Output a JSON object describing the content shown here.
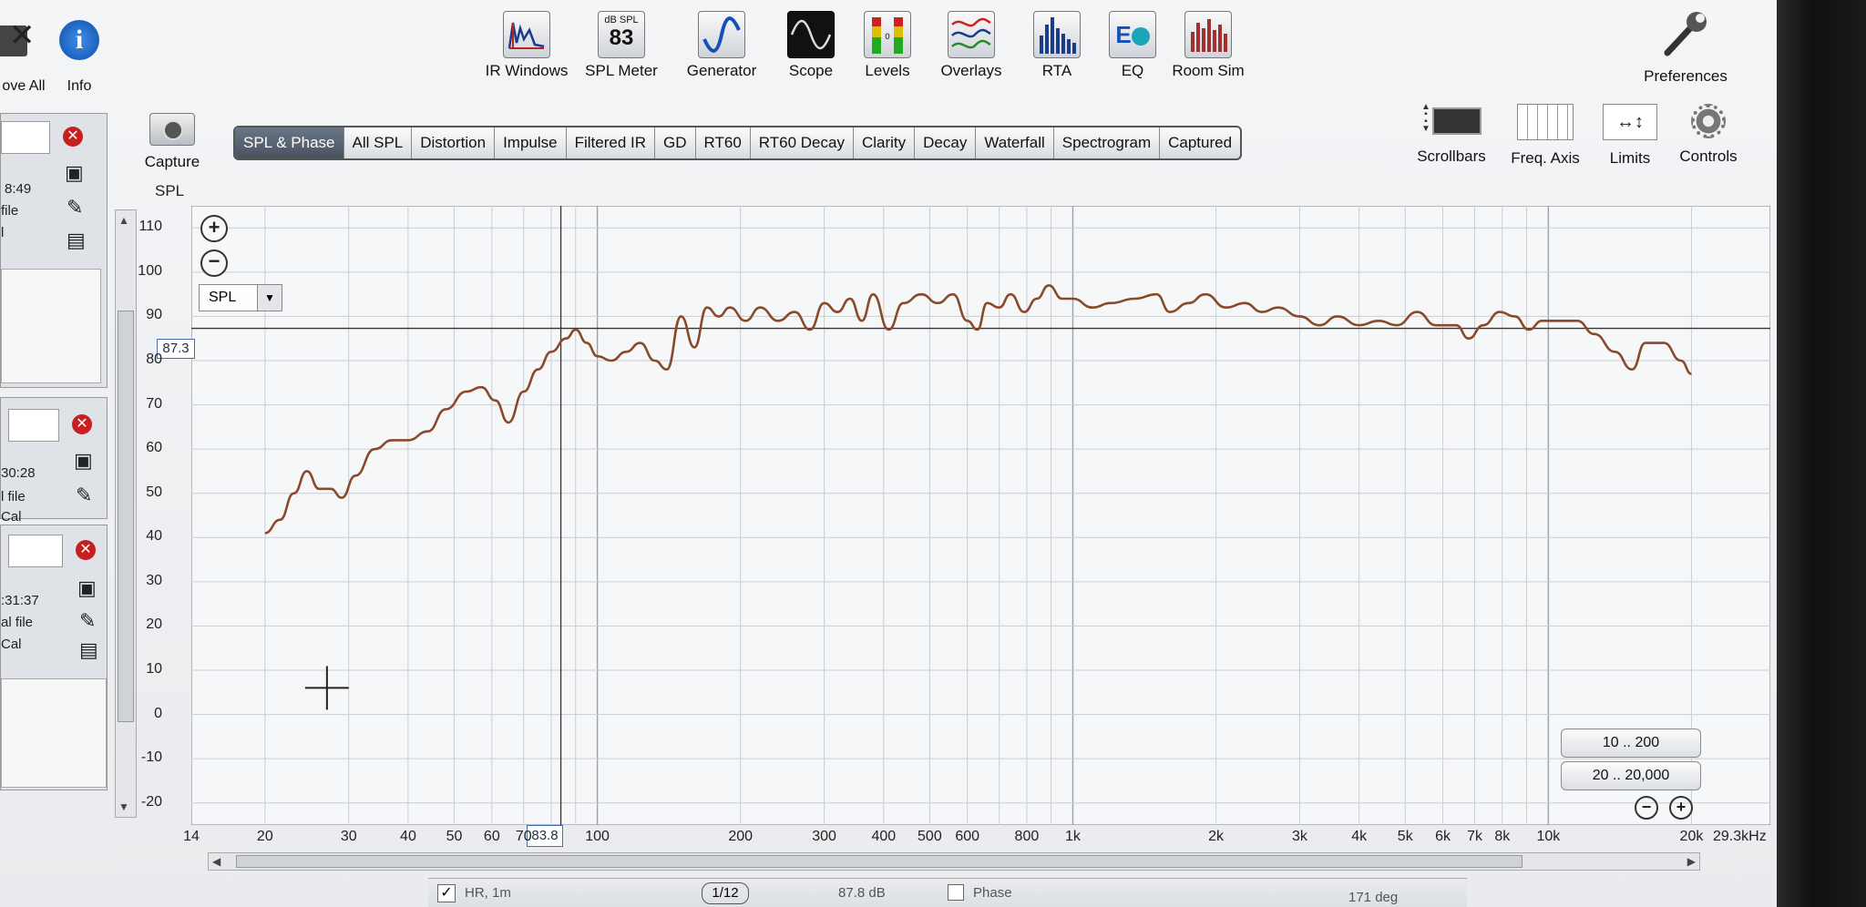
{
  "toolbar": {
    "left_items": [
      {
        "label": "ove All",
        "icon": "remove-all-icon"
      },
      {
        "label": "Info",
        "icon": "info-icon"
      }
    ],
    "items": [
      {
        "label": "IR Windows",
        "icon": "ir-windows-icon"
      },
      {
        "label": "SPL Meter",
        "icon": "spl-meter-icon",
        "icon_top": "dB SPL",
        "icon_value": "83"
      },
      {
        "label": "Generator",
        "icon": "generator-icon"
      },
      {
        "label": "Scope",
        "icon": "scope-icon"
      },
      {
        "label": "Levels",
        "icon": "levels-icon"
      },
      {
        "label": "Overlays",
        "icon": "overlays-icon"
      },
      {
        "label": "RTA",
        "icon": "rta-icon"
      },
      {
        "label": "EQ",
        "icon": "eq-icon"
      },
      {
        "label": "Room Sim",
        "icon": "room-sim-icon"
      }
    ],
    "preferences": "Preferences"
  },
  "capture": {
    "label": "Capture"
  },
  "graph_tabs": [
    "SPL & Phase",
    "All SPL",
    "Distortion",
    "Impulse",
    "Filtered IR",
    "GD",
    "RT60",
    "RT60 Decay",
    "Clarity",
    "Decay",
    "Waterfall",
    "Spectrogram",
    "Captured"
  ],
  "active_tab": "SPL & Phase",
  "right_tools": [
    {
      "label": "Scrollbars",
      "icon": "scrollbars-icon"
    },
    {
      "label": "Freq. Axis",
      "icon": "freq-axis-icon"
    },
    {
      "label": "Limits",
      "icon": "limits-icon"
    },
    {
      "label": "Controls",
      "icon": "gear-icon"
    }
  ],
  "side_measurements": [
    {
      "time": "8:49",
      "line2": "file",
      "line3": "l"
    },
    {
      "time": "30:28",
      "line2": "l file",
      "line3": "Cal"
    },
    {
      "time": ":31:37",
      "line2": "al file",
      "line3": "Cal"
    }
  ],
  "graph": {
    "y_axis_label": "SPL",
    "selector_value": "SPL",
    "cursor_y_value": "87.3",
    "cursor_x_value": "83.8",
    "x_end_label": "29.3kHz",
    "range_buttons": [
      "10 .. 200",
      "20 .. 20,000"
    ]
  },
  "status_bar": {
    "checkbox_label": "HR, 1m",
    "smoothing": "1/12",
    "level": "87.8 dB",
    "phase_label": "Phase",
    "phase_value": "171 deg"
  },
  "chart_data": {
    "type": "line",
    "ylabel": "SPL",
    "x_scale": "log",
    "xlim": [
      14,
      29300
    ],
    "ylim": [
      -25,
      115
    ],
    "y_ticks": [
      110,
      100,
      90,
      80,
      70,
      60,
      50,
      40,
      30,
      20,
      10,
      0,
      -10,
      -20
    ],
    "x_ticks": [
      {
        "v": 14,
        "label": "14"
      },
      {
        "v": 20,
        "label": "20"
      },
      {
        "v": 30,
        "label": "30"
      },
      {
        "v": 40,
        "label": "40"
      },
      {
        "v": 50,
        "label": "50"
      },
      {
        "v": 60,
        "label": "60"
      },
      {
        "v": 70,
        "label": "70"
      },
      {
        "v": 100,
        "label": "100"
      },
      {
        "v": 200,
        "label": "200"
      },
      {
        "v": 300,
        "label": "300"
      },
      {
        "v": 400,
        "label": "400"
      },
      {
        "v": 500,
        "label": "500"
      },
      {
        "v": 600,
        "label": "600"
      },
      {
        "v": 800,
        "label": "800"
      },
      {
        "v": 1000,
        "label": "1k"
      },
      {
        "v": 2000,
        "label": "2k"
      },
      {
        "v": 3000,
        "label": "3k"
      },
      {
        "v": 4000,
        "label": "4k"
      },
      {
        "v": 5000,
        "label": "5k"
      },
      {
        "v": 6000,
        "label": "6k"
      },
      {
        "v": 7000,
        "label": "7k"
      },
      {
        "v": 8000,
        "label": "8k"
      },
      {
        "v": 10000,
        "label": "10k"
      },
      {
        "v": 20000,
        "label": "20k"
      }
    ],
    "cursor": {
      "x": 83.8,
      "y": 87.3
    },
    "series": [
      {
        "color": "#8a4a2a",
        "points": [
          [
            20,
            41
          ],
          [
            21.5,
            44
          ],
          [
            23,
            50
          ],
          [
            24.5,
            55
          ],
          [
            26,
            51
          ],
          [
            27.5,
            51
          ],
          [
            29,
            49
          ],
          [
            31,
            54
          ],
          [
            34,
            60
          ],
          [
            37,
            62
          ],
          [
            40,
            62
          ],
          [
            44,
            64
          ],
          [
            48,
            69
          ],
          [
            53,
            73
          ],
          [
            57,
            74
          ],
          [
            61,
            71
          ],
          [
            65,
            66
          ],
          [
            70,
            73
          ],
          [
            75,
            78
          ],
          [
            80,
            82
          ],
          [
            86,
            85
          ],
          [
            90,
            87
          ],
          [
            95,
            84
          ],
          [
            100,
            81
          ],
          [
            107,
            80
          ],
          [
            115,
            82
          ],
          [
            123,
            84
          ],
          [
            132,
            80
          ],
          [
            140,
            78
          ],
          [
            150,
            90
          ],
          [
            160,
            83
          ],
          [
            170,
            92
          ],
          [
            180,
            90
          ],
          [
            190,
            92
          ],
          [
            205,
            89
          ],
          [
            220,
            92
          ],
          [
            240,
            89
          ],
          [
            260,
            91
          ],
          [
            280,
            87
          ],
          [
            300,
            93
          ],
          [
            320,
            91
          ],
          [
            340,
            94
          ],
          [
            360,
            89
          ],
          [
            380,
            95
          ],
          [
            410,
            87
          ],
          [
            440,
            93
          ],
          [
            480,
            95
          ],
          [
            520,
            93
          ],
          [
            560,
            95
          ],
          [
            600,
            89
          ],
          [
            630,
            87
          ],
          [
            660,
            93
          ],
          [
            700,
            92
          ],
          [
            740,
            95
          ],
          [
            790,
            91
          ],
          [
            840,
            94
          ],
          [
            890,
            97
          ],
          [
            950,
            94
          ],
          [
            1000,
            94
          ],
          [
            1100,
            92
          ],
          [
            1200,
            93
          ],
          [
            1350,
            94
          ],
          [
            1500,
            95
          ],
          [
            1600,
            91
          ],
          [
            1750,
            93
          ],
          [
            1900,
            95
          ],
          [
            2100,
            92
          ],
          [
            2300,
            93
          ],
          [
            2500,
            91
          ],
          [
            2700,
            92
          ],
          [
            3000,
            90
          ],
          [
            3300,
            88
          ],
          [
            3600,
            90
          ],
          [
            4000,
            88
          ],
          [
            4400,
            89
          ],
          [
            4800,
            88
          ],
          [
            5300,
            91
          ],
          [
            5800,
            88
          ],
          [
            6400,
            88
          ],
          [
            6800,
            85
          ],
          [
            7300,
            88
          ],
          [
            7900,
            91
          ],
          [
            8500,
            90
          ],
          [
            9100,
            87
          ],
          [
            9700,
            89
          ],
          [
            10500,
            89
          ],
          [
            11500,
            89
          ],
          [
            12500,
            86
          ],
          [
            13800,
            82
          ],
          [
            15000,
            78
          ],
          [
            16000,
            84
          ],
          [
            17500,
            84
          ],
          [
            19000,
            80
          ],
          [
            20000,
            77
          ]
        ]
      }
    ]
  }
}
